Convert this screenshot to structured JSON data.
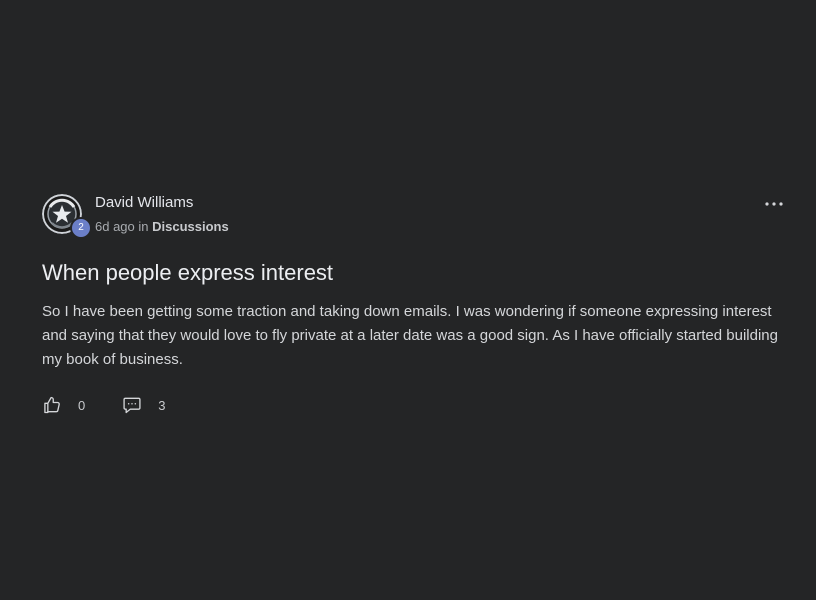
{
  "post": {
    "author": {
      "name": "David Williams",
      "level": "2"
    },
    "timestamp": "6d ago",
    "meta_in": "in",
    "category": "Discussions",
    "title": "When people express interest",
    "body": "So I have been getting some traction and taking down emails. I was wondering if someone expressing interest and saying that they would love to fly private at a later date was a good sign. As I have officially started building my book of business.",
    "likes": "0",
    "comments": "3"
  },
  "icons": {
    "more": "more-horizontal-icon",
    "like": "thumbs-up-icon",
    "comment": "comment-icon",
    "avatar": "star-emblem"
  },
  "colors": {
    "background": "#242526",
    "badge": "#6b7fc8",
    "text_primary": "#e4e6eb",
    "text_secondary": "#a8abaf"
  }
}
